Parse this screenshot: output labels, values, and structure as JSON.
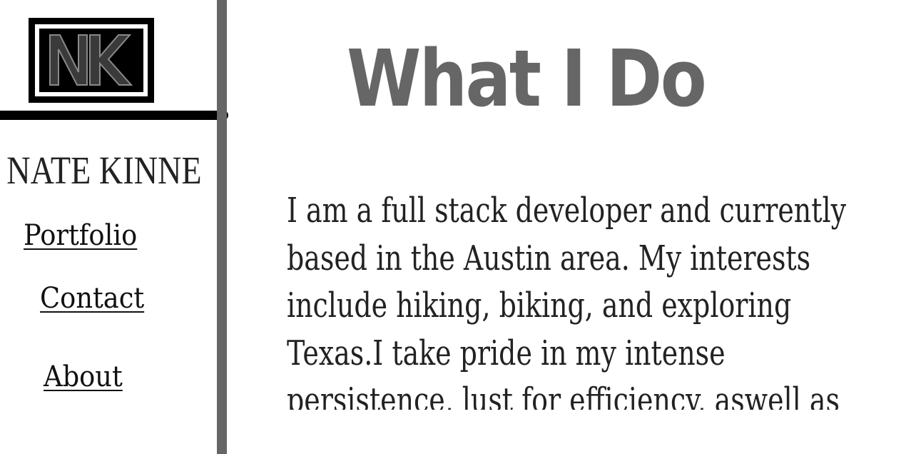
{
  "logo": {
    "alt": "NK",
    "letters": "NK"
  },
  "sidebar": {
    "site_name": "NATE KINNE",
    "nav": [
      {
        "label": "Portfolio"
      },
      {
        "label": "Contact"
      },
      {
        "label": "About"
      }
    ]
  },
  "main": {
    "title": "What I Do",
    "body": "I am a full stack developer and currently based in the Austin area. My interests include hiking, biking, and exploring Texas.I take pride in my intense persistence, lust for efficiency, aswell as my desire to learn."
  },
  "colors": {
    "sidebar_border": "#666666",
    "title": "#666666",
    "text": "#222222"
  }
}
